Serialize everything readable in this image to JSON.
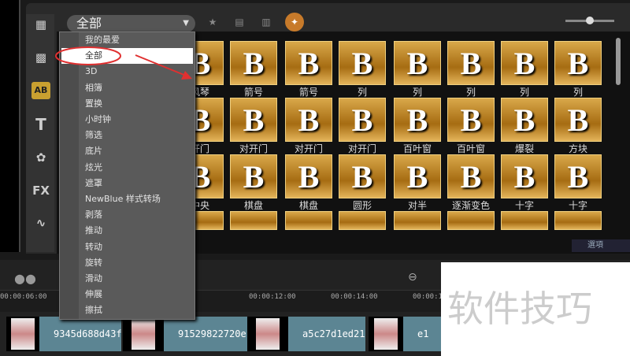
{
  "category_combo": {
    "value": "全部"
  },
  "menu": {
    "items": [
      "我的最爱",
      "全部",
      "3D",
      "相簿",
      "置换",
      "小时钟",
      "筛选",
      "底片",
      "炫光",
      "遮罩",
      "NewBlue 样式转场",
      "剥落",
      "推动",
      "转动",
      "旋转",
      "滑动",
      "伸展",
      "擦拭"
    ],
    "selected": "全部"
  },
  "side_icons": [
    "media-icon",
    "instant-project-icon",
    "transition-icon",
    "title-icon",
    "graphic-icon",
    "filter-icon",
    "path-icon"
  ],
  "side_labels": {
    "ab": "AB",
    "t": "T",
    "fx": "FX"
  },
  "tile_glyph": "B",
  "tiles": [
    [
      "风琴",
      "箭号",
      "箭号",
      "列",
      "列",
      "列",
      "列",
      "列"
    ],
    [
      "开门",
      "对开门",
      "对开门",
      "对开门",
      "百叶窗",
      "百叶窗",
      "爆裂",
      "方块"
    ],
    [
      "中央",
      "棋盘",
      "棋盘",
      "圆形",
      "对半",
      "逐渐变色",
      "十字",
      "十字"
    ]
  ],
  "options_label": "選項",
  "timeline": {
    "ticks": [
      "00:00:06:00",
      "00:00:12:00",
      "00:00:14:00",
      "00:00:16"
    ],
    "clips": [
      "9345d688d43f8",
      "91529822720e",
      "a5c27d1ed21b",
      "e1"
    ]
  },
  "watermark": "软件技巧",
  "annotation_color": "#e03030"
}
